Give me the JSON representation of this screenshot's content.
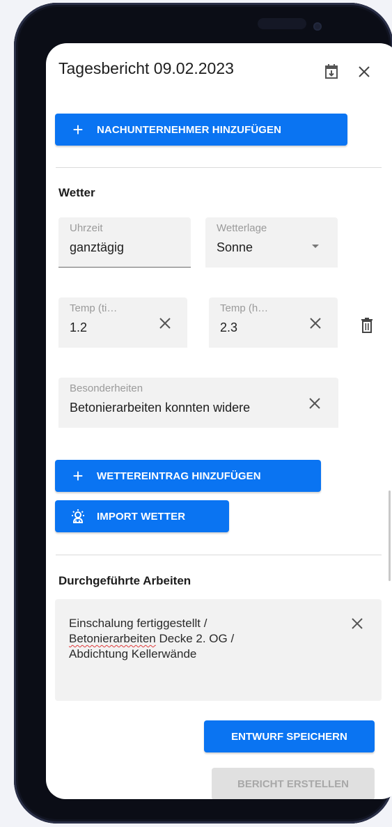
{
  "header": {
    "title": "Tagesbericht 09.02.2023",
    "calendar_icon": "calendar-download-icon",
    "close_icon": "close-icon"
  },
  "subcontractor": {
    "add_label": "NACHUNTERNEHMER HINZUFÜGEN"
  },
  "weather": {
    "heading": "Wetter",
    "time_label": "Uhrzeit",
    "time_value": "ganztägig",
    "condition_label": "Wetterlage",
    "condition_value": "Sonne",
    "temp_low_label": "Temp (ti…",
    "temp_low_value": "1.2",
    "temp_high_label": "Temp (h…",
    "temp_high_value": "2.3",
    "notes_label": "Besonderheiten",
    "notes_value": "Betonierarbeiten konnten widere",
    "add_entry_label": "WETTEREINTRAG HINZUFÜGEN",
    "import_label": "IMPORT WETTER"
  },
  "work": {
    "heading": "Durchgeführte Arbeiten",
    "line1": "Einschalung fertiggestellt /",
    "line2_misspelled": "Betonierarbeiten",
    "line2_rest": " Decke 2. OG /",
    "line3": "Abdichtung Kellerwände"
  },
  "actions": {
    "save_draft": "ENTWURF SPEICHERN",
    "create_report": "BERICHT ERSTELLEN"
  },
  "colors": {
    "primary": "#0a74f2",
    "disabled_bg": "#e0e0e0",
    "disabled_text": "#a8a8a8",
    "field_bg": "#f2f2f2"
  }
}
